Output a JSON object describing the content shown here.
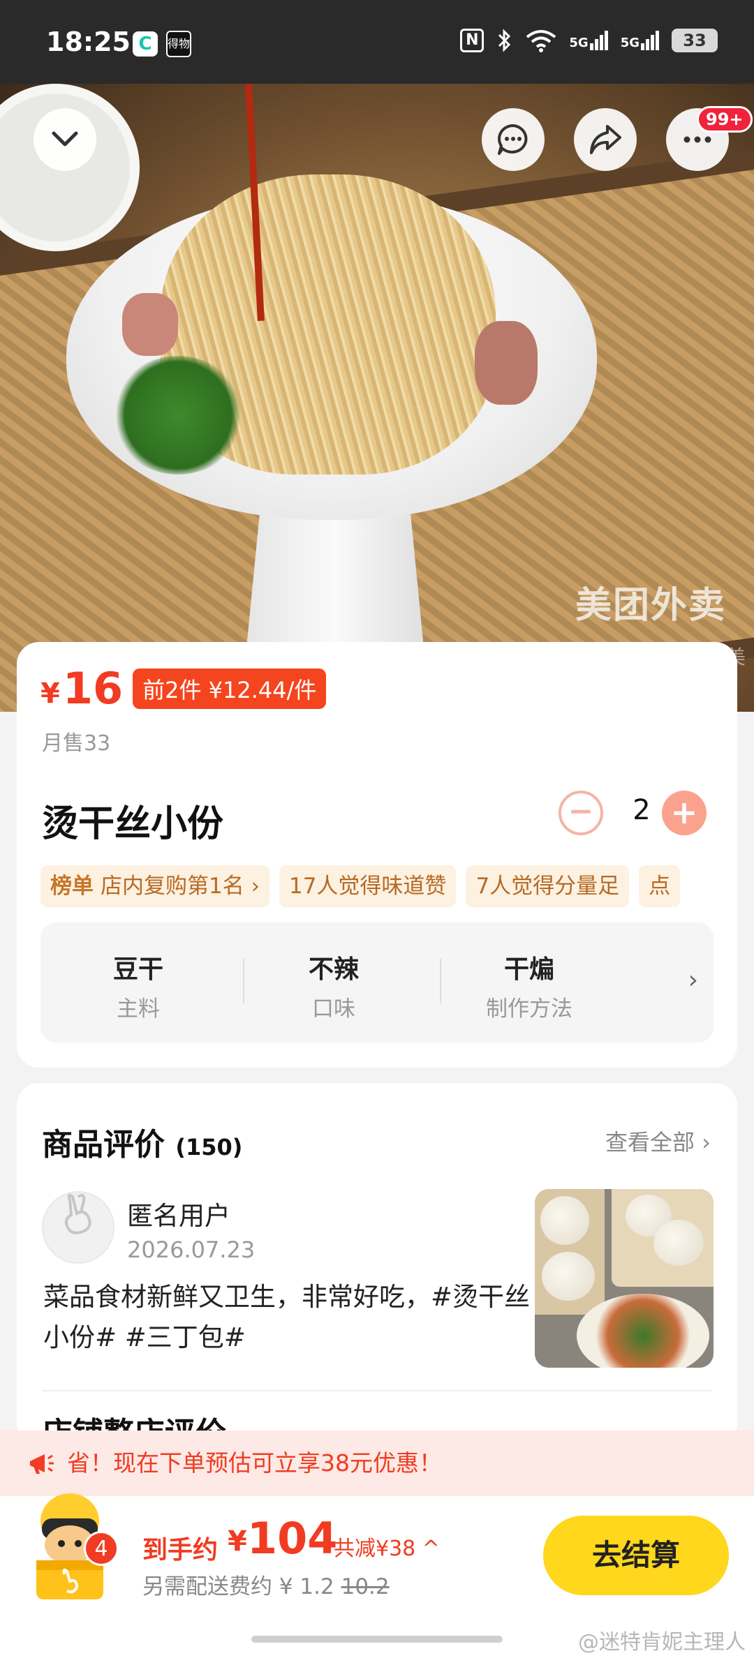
{
  "status_bar": {
    "time": "18:25",
    "app1_glyph": "C",
    "app2_glyph": "得物",
    "nfc": "N",
    "signal1": "5G",
    "signal2": "5G",
    "battery": "33"
  },
  "hero": {
    "watermark": "美团外卖",
    "watermark_small": "美"
  },
  "top_actions": {
    "more_badge": "99+"
  },
  "product": {
    "price_symbol": "¥",
    "price": "16",
    "promo_tag": "前2件 ¥12.44/件",
    "monthly_sales": "月售33",
    "name": "烫干丝小份",
    "quantity": "2",
    "minus_label": "−",
    "plus_label": "+",
    "tags": [
      {
        "prefix": "榜单",
        "text": "店内复购第1名 ›"
      },
      {
        "text": "17人觉得味道赞"
      },
      {
        "text": "7人觉得分量足"
      },
      {
        "text": "点"
      }
    ],
    "attributes": [
      {
        "value": "豆干",
        "key": "主料"
      },
      {
        "value": "不辣",
        "key": "口味"
      },
      {
        "value": "干煸",
        "key": "制作方法"
      }
    ],
    "attr_more": "›"
  },
  "reviews": {
    "title": "商品评价",
    "count": "(150)",
    "see_all": "查看全部 ›",
    "items": [
      {
        "user": "匿名用户",
        "date": "2026.07.23",
        "text": "菜品食材新鲜又卫生，非常好吃，#烫干丝小份# #三丁包#"
      }
    ],
    "next_section": "店铺整店评价"
  },
  "promo_banner": {
    "text": "省！现在下单预估可立享38元优惠！"
  },
  "checkout_bar": {
    "cart_count": "4",
    "estimate_label": "到手约",
    "estimate_symbol": "¥",
    "estimate_value": "104",
    "total_saving": "共减¥38 ^",
    "delivery_label": "另需配送费约 ¥ 1.2",
    "delivery_original": "10.2",
    "checkout_label": "去结算"
  },
  "footer": {
    "weibo_watermark": "@迷特肯妮主理人"
  },
  "colors": {
    "accent_red": "#f13b22",
    "checkout_yellow": "#ffd71c",
    "tag_bg": "#fdf1e1",
    "promo_bg": "#fde9e5"
  }
}
